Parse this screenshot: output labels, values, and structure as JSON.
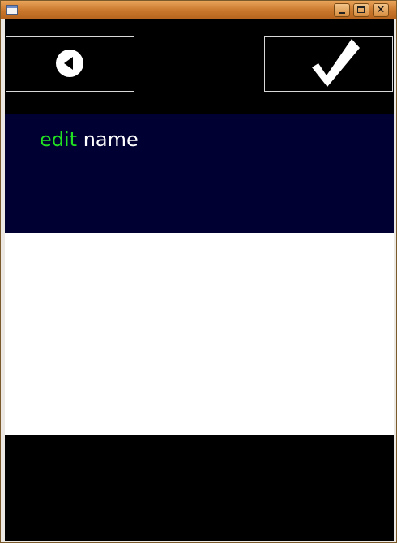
{
  "window": {
    "title": "",
    "controls": {
      "minimize_icon": "minimize-icon",
      "maximize_icon": "maximize-icon",
      "close_icon": "close-icon",
      "close_glyph": "✕"
    }
  },
  "toolbar": {
    "back_button": {
      "icon": "back-arrow-icon"
    },
    "confirm_button": {
      "icon": "checkmark-icon"
    }
  },
  "header": {
    "accent_word": "edit",
    "title_word": "name"
  },
  "editor": {
    "value": ""
  },
  "colors": {
    "accent": "#21e021",
    "header_background": "#000033",
    "toolbar_background": "#000000",
    "editor_background": "#ffffff"
  }
}
